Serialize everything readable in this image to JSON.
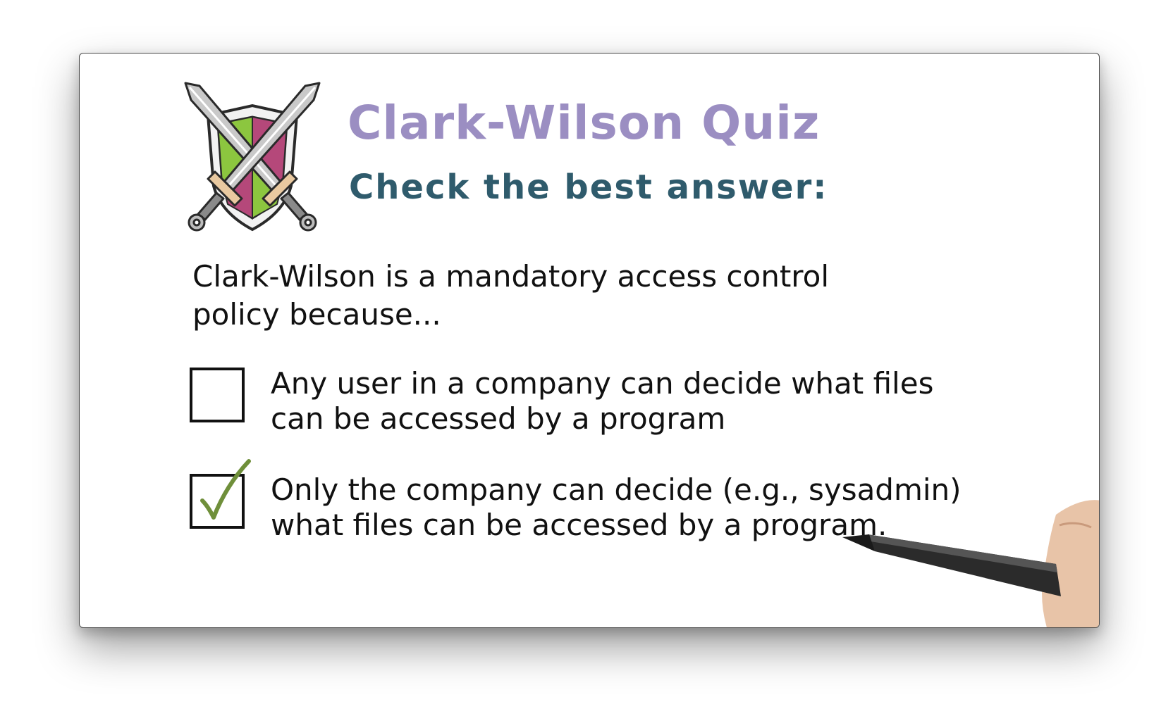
{
  "quiz": {
    "title": "Clark-Wilson Quiz",
    "subtitle": "Check the best answer:",
    "question": "Clark-Wilson is a mandatory access control policy because...",
    "options": [
      {
        "text": "Any user in a company can decide what files can be accessed by a program",
        "checked": false
      },
      {
        "text": "Only the company can decide (e.g., sysadmin) what files can be accessed by a program.",
        "checked": true
      }
    ]
  },
  "colors": {
    "title": "#9b8ec2",
    "subtitle": "#2f5b6c",
    "text": "#111111",
    "checkmark": "#6f8f3a",
    "shield_green": "#8cc63f",
    "shield_magenta": "#b5487a"
  },
  "icons": {
    "emblem": "crossed-swords-shield-icon",
    "checkmark": "checkmark-icon",
    "pen": "marker-pen-icon"
  }
}
